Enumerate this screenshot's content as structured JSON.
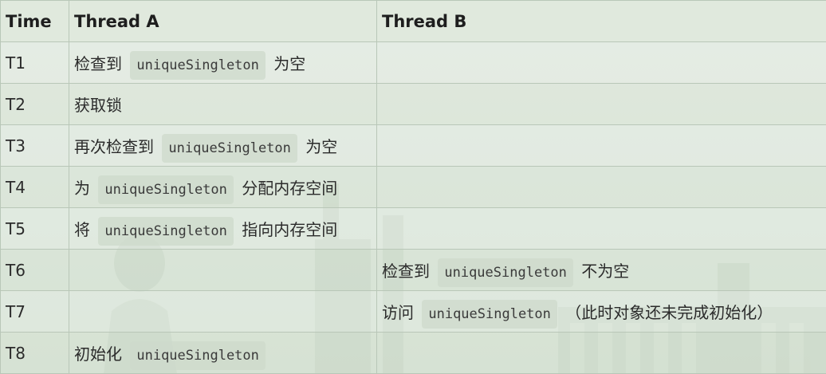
{
  "columns": [
    "Time",
    "Thread A",
    "Thread B"
  ],
  "rows": [
    {
      "time": "T1",
      "a": {
        "pre": "检查到",
        "code": "uniqueSingleton",
        "post": "为空"
      },
      "b": null
    },
    {
      "time": "T2",
      "a": {
        "pre": "获取锁",
        "code": null,
        "post": ""
      },
      "b": null
    },
    {
      "time": "T3",
      "a": {
        "pre": "再次检查到",
        "code": "uniqueSingleton",
        "post": "为空"
      },
      "b": null
    },
    {
      "time": "T4",
      "a": {
        "pre": "为",
        "code": "uniqueSingleton",
        "post": "分配内存空间"
      },
      "b": null
    },
    {
      "time": "T5",
      "a": {
        "pre": "将",
        "code": "uniqueSingleton",
        "post": "指向内存空间"
      },
      "b": null
    },
    {
      "time": "T6",
      "a": null,
      "b": {
        "pre": "检查到",
        "code": "uniqueSingleton",
        "post": "不为空"
      }
    },
    {
      "time": "T7",
      "a": null,
      "b": {
        "pre": "访问",
        "code": "uniqueSingleton",
        "post": "（此时对象还未完成初始化）"
      }
    },
    {
      "time": "T8",
      "a": {
        "pre": "初始化",
        "code": "uniqueSingleton",
        "post": ""
      },
      "b": null
    }
  ]
}
